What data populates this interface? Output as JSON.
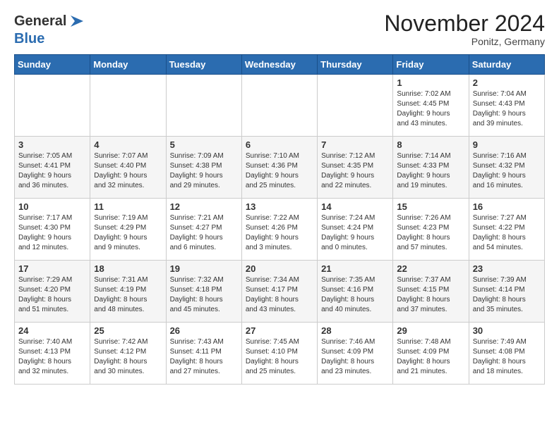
{
  "header": {
    "logo_general": "General",
    "logo_blue": "Blue",
    "month_title": "November 2024",
    "location": "Ponitz, Germany"
  },
  "weekdays": [
    "Sunday",
    "Monday",
    "Tuesday",
    "Wednesday",
    "Thursday",
    "Friday",
    "Saturday"
  ],
  "weeks": [
    [
      {
        "day": "",
        "info": ""
      },
      {
        "day": "",
        "info": ""
      },
      {
        "day": "",
        "info": ""
      },
      {
        "day": "",
        "info": ""
      },
      {
        "day": "",
        "info": ""
      },
      {
        "day": "1",
        "info": "Sunrise: 7:02 AM\nSunset: 4:45 PM\nDaylight: 9 hours\nand 43 minutes."
      },
      {
        "day": "2",
        "info": "Sunrise: 7:04 AM\nSunset: 4:43 PM\nDaylight: 9 hours\nand 39 minutes."
      }
    ],
    [
      {
        "day": "3",
        "info": "Sunrise: 7:05 AM\nSunset: 4:41 PM\nDaylight: 9 hours\nand 36 minutes."
      },
      {
        "day": "4",
        "info": "Sunrise: 7:07 AM\nSunset: 4:40 PM\nDaylight: 9 hours\nand 32 minutes."
      },
      {
        "day": "5",
        "info": "Sunrise: 7:09 AM\nSunset: 4:38 PM\nDaylight: 9 hours\nand 29 minutes."
      },
      {
        "day": "6",
        "info": "Sunrise: 7:10 AM\nSunset: 4:36 PM\nDaylight: 9 hours\nand 25 minutes."
      },
      {
        "day": "7",
        "info": "Sunrise: 7:12 AM\nSunset: 4:35 PM\nDaylight: 9 hours\nand 22 minutes."
      },
      {
        "day": "8",
        "info": "Sunrise: 7:14 AM\nSunset: 4:33 PM\nDaylight: 9 hours\nand 19 minutes."
      },
      {
        "day": "9",
        "info": "Sunrise: 7:16 AM\nSunset: 4:32 PM\nDaylight: 9 hours\nand 16 minutes."
      }
    ],
    [
      {
        "day": "10",
        "info": "Sunrise: 7:17 AM\nSunset: 4:30 PM\nDaylight: 9 hours\nand 12 minutes."
      },
      {
        "day": "11",
        "info": "Sunrise: 7:19 AM\nSunset: 4:29 PM\nDaylight: 9 hours\nand 9 minutes."
      },
      {
        "day": "12",
        "info": "Sunrise: 7:21 AM\nSunset: 4:27 PM\nDaylight: 9 hours\nand 6 minutes."
      },
      {
        "day": "13",
        "info": "Sunrise: 7:22 AM\nSunset: 4:26 PM\nDaylight: 9 hours\nand 3 minutes."
      },
      {
        "day": "14",
        "info": "Sunrise: 7:24 AM\nSunset: 4:24 PM\nDaylight: 9 hours\nand 0 minutes."
      },
      {
        "day": "15",
        "info": "Sunrise: 7:26 AM\nSunset: 4:23 PM\nDaylight: 8 hours\nand 57 minutes."
      },
      {
        "day": "16",
        "info": "Sunrise: 7:27 AM\nSunset: 4:22 PM\nDaylight: 8 hours\nand 54 minutes."
      }
    ],
    [
      {
        "day": "17",
        "info": "Sunrise: 7:29 AM\nSunset: 4:20 PM\nDaylight: 8 hours\nand 51 minutes."
      },
      {
        "day": "18",
        "info": "Sunrise: 7:31 AM\nSunset: 4:19 PM\nDaylight: 8 hours\nand 48 minutes."
      },
      {
        "day": "19",
        "info": "Sunrise: 7:32 AM\nSunset: 4:18 PM\nDaylight: 8 hours\nand 45 minutes."
      },
      {
        "day": "20",
        "info": "Sunrise: 7:34 AM\nSunset: 4:17 PM\nDaylight: 8 hours\nand 43 minutes."
      },
      {
        "day": "21",
        "info": "Sunrise: 7:35 AM\nSunset: 4:16 PM\nDaylight: 8 hours\nand 40 minutes."
      },
      {
        "day": "22",
        "info": "Sunrise: 7:37 AM\nSunset: 4:15 PM\nDaylight: 8 hours\nand 37 minutes."
      },
      {
        "day": "23",
        "info": "Sunrise: 7:39 AM\nSunset: 4:14 PM\nDaylight: 8 hours\nand 35 minutes."
      }
    ],
    [
      {
        "day": "24",
        "info": "Sunrise: 7:40 AM\nSunset: 4:13 PM\nDaylight: 8 hours\nand 32 minutes."
      },
      {
        "day": "25",
        "info": "Sunrise: 7:42 AM\nSunset: 4:12 PM\nDaylight: 8 hours\nand 30 minutes."
      },
      {
        "day": "26",
        "info": "Sunrise: 7:43 AM\nSunset: 4:11 PM\nDaylight: 8 hours\nand 27 minutes."
      },
      {
        "day": "27",
        "info": "Sunrise: 7:45 AM\nSunset: 4:10 PM\nDaylight: 8 hours\nand 25 minutes."
      },
      {
        "day": "28",
        "info": "Sunrise: 7:46 AM\nSunset: 4:09 PM\nDaylight: 8 hours\nand 23 minutes."
      },
      {
        "day": "29",
        "info": "Sunrise: 7:48 AM\nSunset: 4:09 PM\nDaylight: 8 hours\nand 21 minutes."
      },
      {
        "day": "30",
        "info": "Sunrise: 7:49 AM\nSunset: 4:08 PM\nDaylight: 8 hours\nand 18 minutes."
      }
    ]
  ]
}
